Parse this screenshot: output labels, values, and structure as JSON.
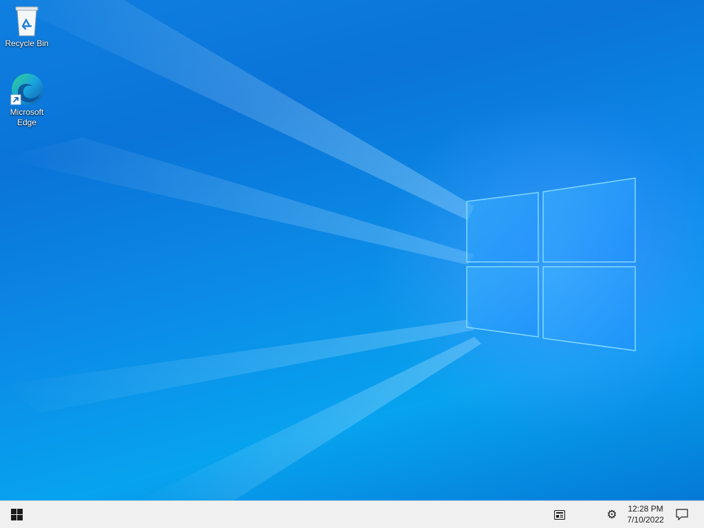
{
  "desktop": {
    "wallpaper": "windows-10-blue-light-wallpaper",
    "icons": [
      {
        "label": "Recycle Bin",
        "icon": "recycle-bin-icon"
      },
      {
        "label": "Microsoft Edge",
        "icon": "microsoft-edge-icon"
      }
    ]
  },
  "taskbar": {
    "start_icon": "windows-logo-icon",
    "tray": {
      "news_icon": "news-and-interests-icon",
      "settings_icon": "gear-icon",
      "time": "12:28 PM",
      "date": "7/10/2022",
      "notification_icon": "action-center-icon"
    }
  },
  "colors": {
    "wallpaper_primary": "#0a78d8",
    "taskbar_background": "#f0f0f0",
    "accent": "#0078d4"
  }
}
